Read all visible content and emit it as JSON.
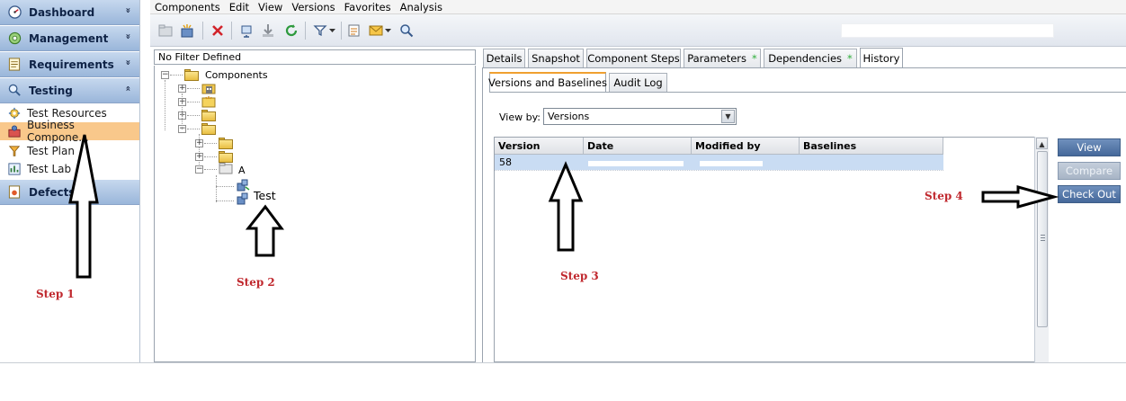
{
  "sidebar": {
    "sections": [
      {
        "label": "Dashboard",
        "icon": "dashboard-icon",
        "chevron": "»"
      },
      {
        "label": "Management",
        "icon": "management-icon",
        "chevron": "»"
      },
      {
        "label": "Requirements",
        "icon": "requirements-icon",
        "chevron": "»"
      },
      {
        "label": "Testing",
        "icon": "testing-icon",
        "chevron": "«"
      }
    ],
    "items": [
      {
        "label": "Test Resources",
        "icon": "test-resources-icon"
      },
      {
        "label": "Business Compone...",
        "icon": "business-components-icon",
        "selected": true
      },
      {
        "label": "Test Plan",
        "icon": "test-plan-icon"
      },
      {
        "label": "Test Lab",
        "icon": "test-lab-icon"
      }
    ],
    "defects": {
      "label": "Defects",
      "icon": "defects-icon"
    }
  },
  "menu": [
    "Components",
    "Edit",
    "View",
    "Versions",
    "Favorites",
    "Analysis"
  ],
  "filter_text": "No Filter Defined",
  "tree": {
    "root": "Components",
    "child_a": "A",
    "leaf": "Test"
  },
  "tabs": [
    {
      "label": "Details",
      "star": ""
    },
    {
      "label": "Snapshot",
      "star": ""
    },
    {
      "label": "Component Steps",
      "star": ""
    },
    {
      "label": "Parameters",
      "star": "*"
    },
    {
      "label": "Dependencies",
      "star": "*"
    },
    {
      "label": "History",
      "star": "",
      "active": true
    }
  ],
  "subtabs": [
    "Versions and Baselines",
    "Audit Log"
  ],
  "view_by": {
    "label": "View by:",
    "value": "Versions"
  },
  "grid": {
    "columns": [
      "Version",
      "Date",
      "Modified by",
      "Baselines"
    ],
    "rows": [
      {
        "version": "58",
        "date": "",
        "modified_by": "",
        "baselines": ""
      }
    ]
  },
  "buttons": {
    "view": "View",
    "compare": "Compare",
    "check_out": "Check Out"
  },
  "steps": [
    "Step 1",
    "Step 2",
    "Step 3",
    "Step 4"
  ],
  "colors": {
    "selected_nav": "#f9c88b",
    "step_text": "#c0282e",
    "primary_button": "#5677a8",
    "grid_selection": "#c9dcf3"
  }
}
